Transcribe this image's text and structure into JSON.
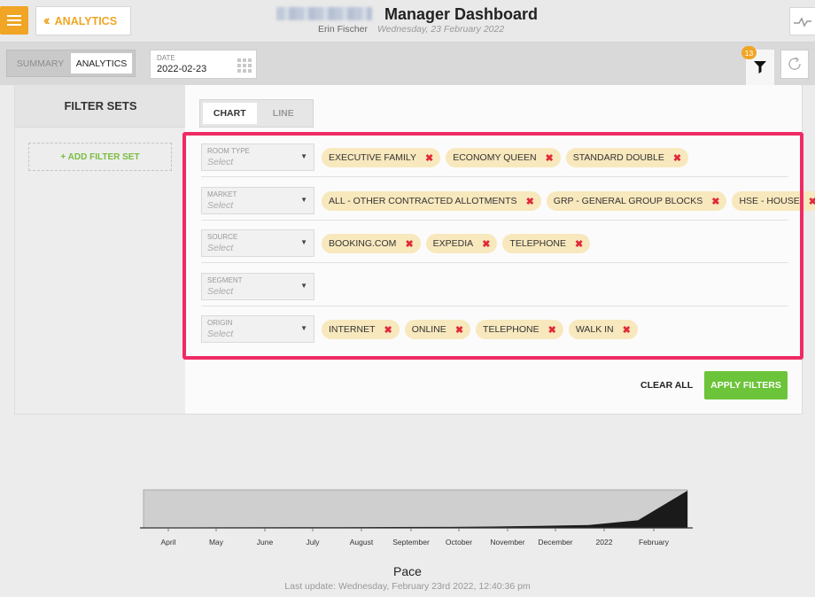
{
  "header": {
    "back_label": "ANALYTICS",
    "title": "Manager Dashboard",
    "user": "Erin Fischer",
    "date": "Wednesday, 23 February 2022"
  },
  "toolbar": {
    "view_tabs": [
      "SUMMARY",
      "ANALYTICS"
    ],
    "active_view": "ANALYTICS",
    "date_label": "DATE",
    "date_value": "2022-02-23",
    "filter_count": "13"
  },
  "sidebar": {
    "title": "FILTER SETS",
    "add_label": "+ ADD FILTER SET"
  },
  "chart_tabs": [
    "CHART",
    "LINE"
  ],
  "filters": [
    {
      "label": "ROOM TYPE",
      "placeholder": "Select",
      "chips": [
        "EXECUTIVE FAMILY",
        "ECONOMY QUEEN",
        "STANDARD DOUBLE"
      ]
    },
    {
      "label": "MARKET",
      "placeholder": "Select",
      "chips": [
        "ALL - OTHER CONTRACTED ALLOTMENTS",
        "GRP - GENERAL GROUP BLOCKS",
        "HSE - HOUSE"
      ]
    },
    {
      "label": "SOURCE",
      "placeholder": "Select",
      "chips": [
        "BOOKING.COM",
        "EXPEDIA",
        "TELEPHONE"
      ]
    },
    {
      "label": "SEGMENT",
      "placeholder": "Select",
      "chips": []
    },
    {
      "label": "ORIGIN",
      "placeholder": "Select",
      "chips": [
        "INTERNET",
        "ONLINE",
        "TELEPHONE",
        "WALK IN"
      ]
    }
  ],
  "actions": {
    "clear_all": "CLEAR ALL",
    "apply": "APPLY FILTERS"
  },
  "pace": {
    "title": "Pace",
    "last_update": "Last update: Wednesday, February 23rd 2022, 12:40:36 pm"
  },
  "chart_data": {
    "type": "area",
    "title": "Pace",
    "xlabel": "",
    "ylabel": "",
    "categories": [
      "April",
      "May",
      "June",
      "July",
      "August",
      "September",
      "October",
      "November",
      "December",
      "2022",
      "February"
    ],
    "values": [
      0.5,
      0.5,
      0.6,
      0.7,
      0.8,
      1.0,
      1.2,
      1.6,
      2.3,
      3.5,
      9.0,
      44.0
    ],
    "ylim": [
      0,
      45
    ],
    "grid": false,
    "colors": {
      "fill": "#1a1a1a",
      "background": "#cfcfcf"
    }
  }
}
